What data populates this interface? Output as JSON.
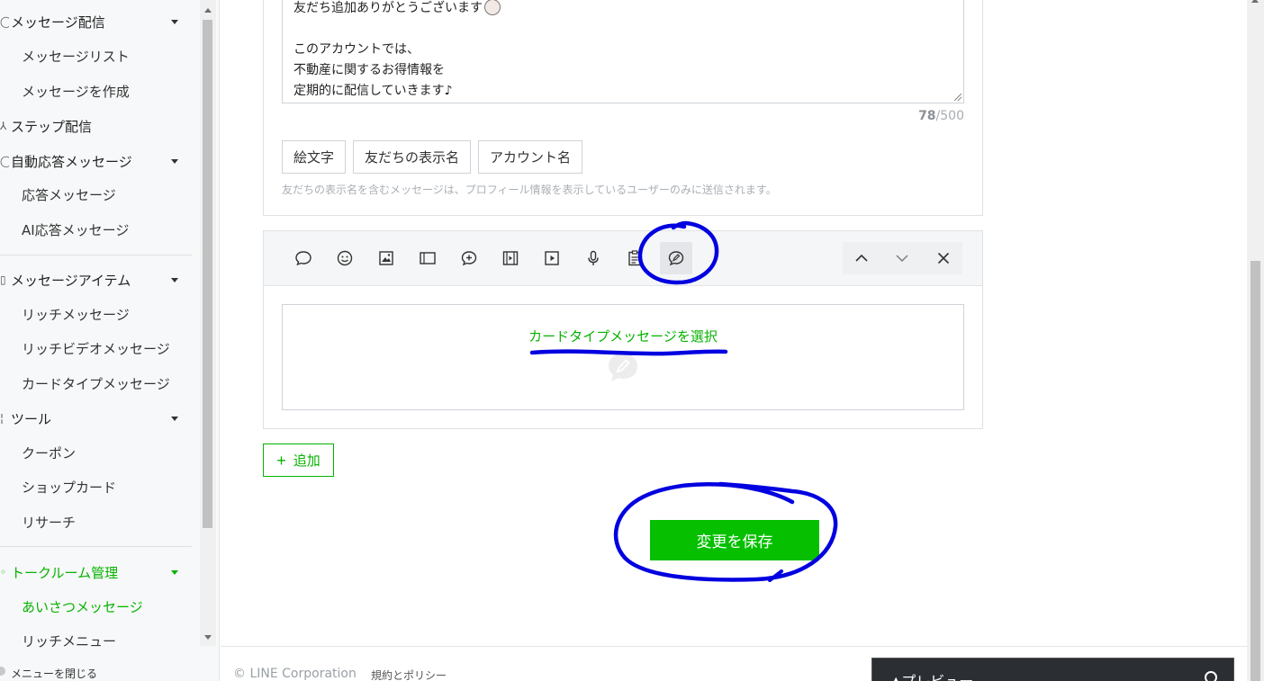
{
  "sidebar": {
    "sections": [
      {
        "icon": "message-icon",
        "label": "メッセージ配信"
      },
      {
        "icon": "step-icon",
        "label": "ステップ配信"
      },
      {
        "icon": "auto-reply-icon",
        "label": "自動応答メッセージ"
      },
      {
        "icon": "item-icon",
        "label": "メッセージアイテム"
      },
      {
        "icon": "tool-icon",
        "label": "ツール"
      },
      {
        "icon": "talkroom-icon",
        "label": "トークルーム管理"
      }
    ],
    "items": {
      "message_list": "メッセージリスト",
      "message_create": "メッセージを作成",
      "auto_reply": "応答メッセージ",
      "ai_reply": "AI応答メッセージ",
      "rich_message": "リッチメッセージ",
      "rich_video": "リッチビデオメッセージ",
      "card_type": "カードタイプメッセージ",
      "coupon": "クーポン",
      "shop_card": "ショップカード",
      "research": "リサーチ",
      "greeting": "あいさつメッセージ",
      "rich_menu": "リッチメニュー"
    },
    "close_menu": "メニューを閉じる"
  },
  "editor": {
    "lines": [
      "友だち追加ありがとうございます",
      "",
      "このアカウントでは、",
      "不動産に関するお得情報を",
      "定期的に配信していきます♪"
    ],
    "char_count": "78",
    "char_limit": "/500",
    "chips": [
      "絵文字",
      "友だちの表示名",
      "アカウント名"
    ],
    "note": "友だちの表示名を含むメッセージは、プロフィール情報を表示しているユーザーのみに送信されます。"
  },
  "toolbar": {
    "icons": [
      "text-message-icon",
      "sticker-icon",
      "image-icon",
      "coupon-icon",
      "rich-message-icon",
      "rich-video-icon",
      "video-icon",
      "voice-icon",
      "research-icon",
      "card-type-icon"
    ],
    "right_icons": [
      "move-up-icon",
      "move-down-icon",
      "delete-icon"
    ]
  },
  "dropzone": {
    "link": "カードタイプメッセージを選択"
  },
  "actions": {
    "add_label": "追加",
    "save_label": "変更を保存"
  },
  "footer": {
    "copyright": "© LINE Corporation",
    "policy": "規約とポリシー"
  },
  "preview": {
    "label": "▲プレビュー"
  },
  "colors": {
    "accent": "#06c000",
    "annotation": "#0000e0"
  }
}
